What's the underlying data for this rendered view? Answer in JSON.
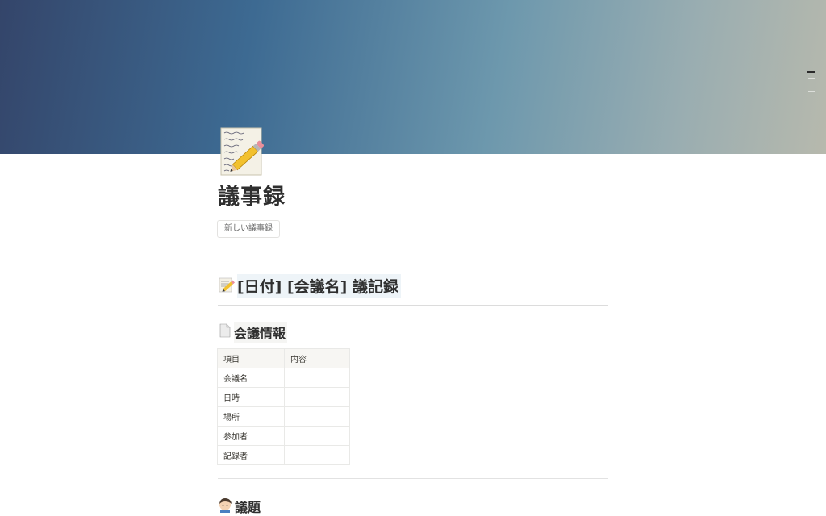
{
  "cover": {
    "gradient_colors": [
      "#34456a",
      "#3d6a92",
      "#6d98ad",
      "#b7b9ad"
    ]
  },
  "page": {
    "icon": "memo-pencil-icon",
    "title": "議事録",
    "new_button_label": "新しい議事録"
  },
  "section1": {
    "icon": "memo-icon",
    "heading": "[日付] [会議名] 議記録"
  },
  "section2": {
    "icon": "page-icon",
    "heading": "会議情報",
    "table": {
      "headers": [
        "項目",
        "内容"
      ],
      "rows": [
        [
          "会議名",
          ""
        ],
        [
          "日時",
          ""
        ],
        [
          "場所",
          ""
        ],
        [
          "参加者",
          ""
        ],
        [
          "記録者",
          ""
        ]
      ]
    }
  },
  "section3": {
    "icon": "person-icon",
    "heading": "議題"
  }
}
